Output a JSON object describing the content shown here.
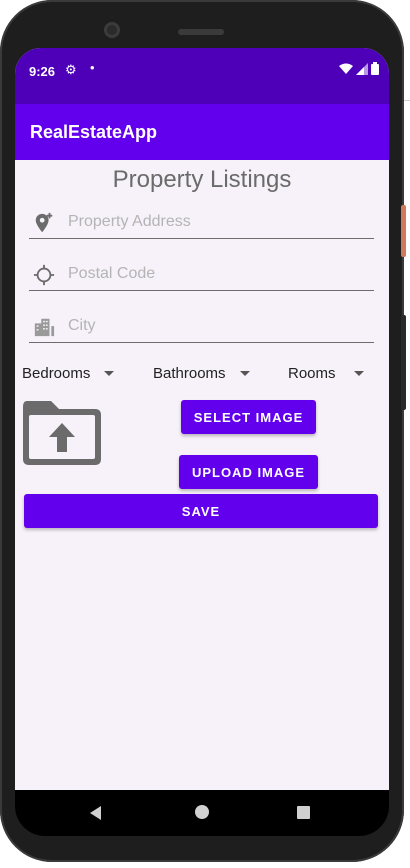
{
  "status_bar": {
    "time": "9:26"
  },
  "app_bar": {
    "title": "RealEstateApp"
  },
  "form": {
    "heading": "Property Listings",
    "address_placeholder": "Property Address",
    "postal_placeholder": "Postal Code",
    "city_placeholder": "City",
    "spinners": {
      "bedrooms": "Bedrooms",
      "bathrooms": "Bathrooms",
      "rooms": "Rooms"
    },
    "select_image_label": "SELECT IMAGE",
    "upload_image_label": "UPLOAD IMAGE",
    "save_label": "SAVE"
  },
  "colors": {
    "primary": "#6200ee",
    "primary_dark": "#4e00b8",
    "background": "#f7f2f9"
  },
  "icons": {
    "address": "add-location-icon",
    "postal": "gps-target-icon",
    "city": "city-buildings-icon",
    "image": "folder-upload-icon"
  }
}
